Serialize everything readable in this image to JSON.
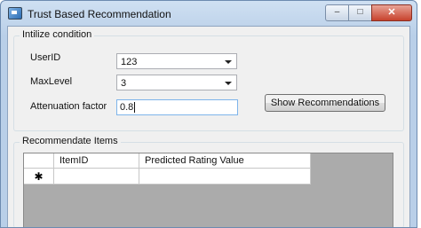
{
  "window": {
    "title": "Trust Based Recommendation",
    "minimize_icon": "minimize-icon",
    "maximize_icon": "maximize-icon",
    "close_icon": "close-icon"
  },
  "init_group": {
    "title": "Intilize condition",
    "userid_label": "UserID",
    "userid_value": "123",
    "maxlevel_label": "MaxLevel",
    "maxlevel_value": "3",
    "attenuation_label": "Attenuation factor",
    "attenuation_value": "0.8",
    "show_button": "Show Recommendations"
  },
  "items_group": {
    "title": "Recommendate Items",
    "columns": [
      "ItemID",
      "Predicted Rating Value"
    ],
    "new_row_marker": "✱"
  }
}
